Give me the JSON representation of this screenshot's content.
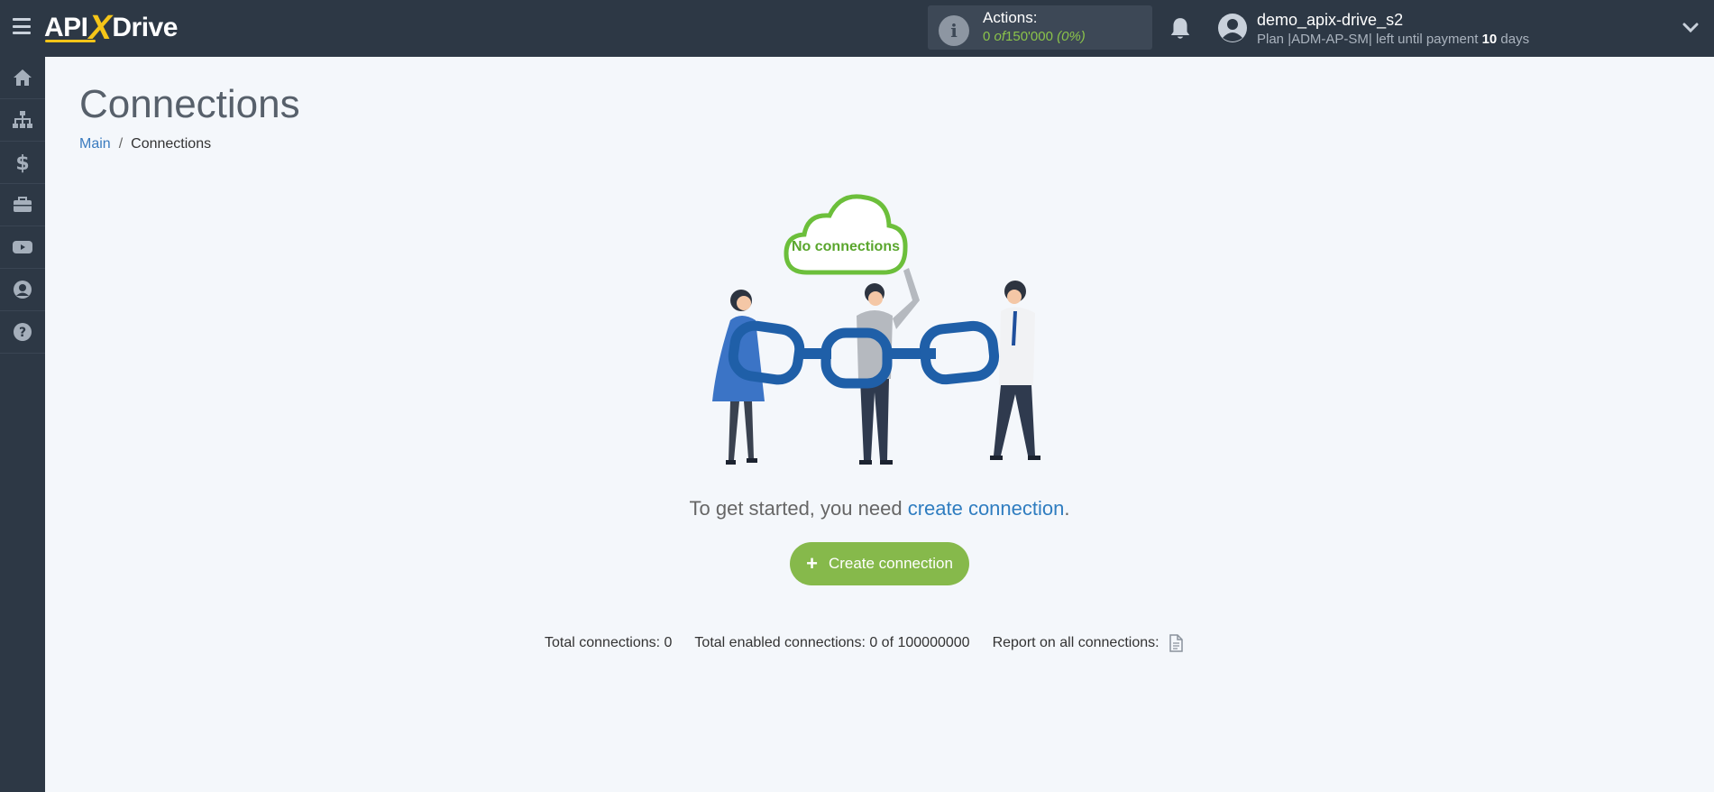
{
  "header": {
    "logo_left": "API",
    "logo_x": "X",
    "logo_right": "Drive",
    "actions": {
      "label": "Actions:",
      "used": "0",
      "of_word": "of",
      "limit": "150'000",
      "percent": "(0%)"
    },
    "user": {
      "name": "demo_apix-drive_s2",
      "plan_prefix": "Plan |ADM-AP-SM| left until payment",
      "days_value": "10",
      "days_unit": "days"
    }
  },
  "sidebar": {
    "items": [
      {
        "icon": "home-icon"
      },
      {
        "icon": "sitemap-icon"
      },
      {
        "icon": "dollar-icon"
      },
      {
        "icon": "briefcase-icon"
      },
      {
        "icon": "youtube-icon"
      },
      {
        "icon": "user-circle-icon"
      },
      {
        "icon": "help-icon"
      }
    ]
  },
  "main": {
    "title": "Connections",
    "breadcrumb": {
      "main": "Main",
      "separator": "/",
      "current": "Connections"
    },
    "cloud_label": "No connections",
    "started_text": "To get started, you need",
    "started_link": "create connection",
    "started_period": ".",
    "create_button": "Create connection",
    "stats": {
      "total": "Total connections: 0",
      "enabled": "Total enabled connections: 0 of 100000000",
      "report": "Report on all connections:"
    }
  },
  "colors": {
    "topbar": "#2d3845",
    "accent_green": "#86b94b",
    "link_blue": "#2f7dc0",
    "logo_yellow": "#f5c518"
  }
}
